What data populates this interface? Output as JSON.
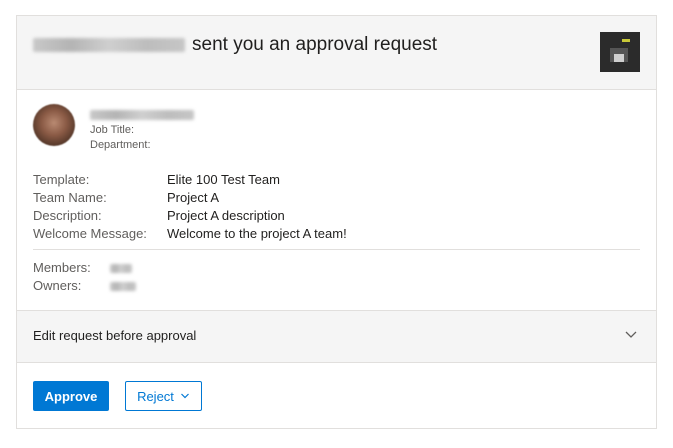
{
  "header": {
    "title_suffix": "sent you an approval request",
    "app_icon": "app-icon"
  },
  "requester": {
    "job_title_label": "Job Title:",
    "department_label": "Department:"
  },
  "details": [
    {
      "label": "Template:",
      "value": "Elite 100 Test Team"
    },
    {
      "label": "Team Name:",
      "value": "Project A"
    },
    {
      "label": "Description:",
      "value": "Project A description"
    },
    {
      "label": "Welcome Message:",
      "value": "Welcome to the project A team!"
    }
  ],
  "members": {
    "members_label": "Members:",
    "owners_label": "Owners:"
  },
  "edit_section": {
    "label": "Edit request before approval",
    "icon": "chevron-down-icon"
  },
  "actions": {
    "approve_label": "Approve",
    "reject_label": "Reject",
    "reject_icon": "chevron-down-icon"
  },
  "colors": {
    "accent": "#0078d4",
    "header_bg": "#f5f5f5",
    "border": "#e1dfdd"
  }
}
